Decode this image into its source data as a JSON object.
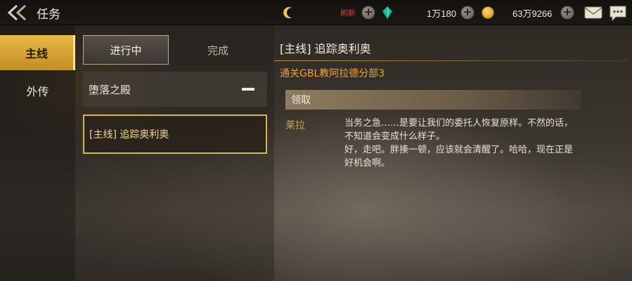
{
  "header": {
    "title": "任务",
    "refresh_label": "刷新",
    "currency_a": "1万180",
    "currency_b": "63万9266"
  },
  "sidebar": {
    "tabs": [
      {
        "label": "主线",
        "active": true
      },
      {
        "label": "外传",
        "active": false
      }
    ]
  },
  "quest_list": {
    "tab_in_progress": "进行中",
    "tab_completed": "完成",
    "group_name": "堕落之殿",
    "items": [
      {
        "label": "[主线] 追踪奥利奥",
        "selected": true
      }
    ]
  },
  "detail": {
    "title": "[主线] 追踪奥利奥",
    "objective": "通关GBL教阿拉德分部3",
    "claim_label": "领取",
    "npc_name": "莱拉",
    "dialogue_line1": "当务之急……是要让我们的委托人恢复原样。不然的话，不知道会变成什么样子。",
    "dialogue_line2": "好，走吧。胖揍一顿，应该就会清醒了。哈哈，现在正是好机会啊。"
  },
  "icons": {
    "back": "back-arrow-icon",
    "moon": "crescent-moon-icon",
    "gem": "green-gem-icon",
    "coin": "gold-coin-icon",
    "mail": "mail-icon",
    "chat": "chat-icon"
  },
  "colors": {
    "accent_gold": "#d9b450",
    "objective_orange": "#f0a33a",
    "refresh_red": "#e23b2e",
    "npc_name": "#c8a254"
  }
}
